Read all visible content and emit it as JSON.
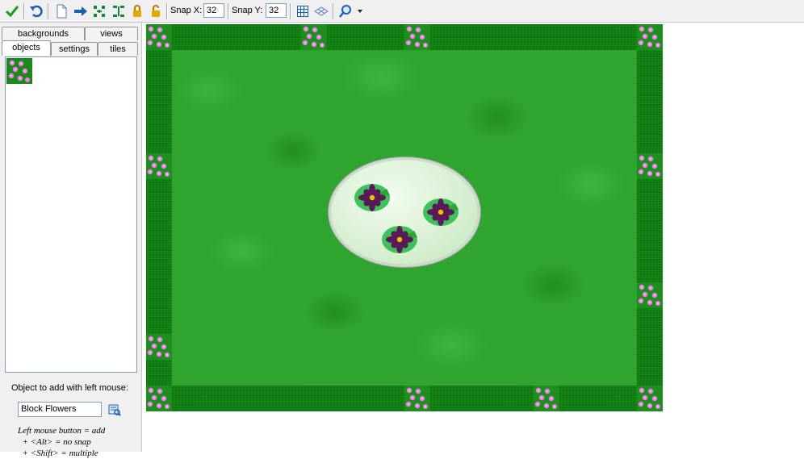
{
  "toolbar": {
    "buttons": [
      {
        "name": "confirm-button",
        "icon": "check-icon"
      },
      {
        "name": "undo-button",
        "icon": "undo-icon"
      },
      {
        "name": "clear-room-button",
        "icon": "blank-page-icon"
      },
      {
        "name": "shift-instances-button",
        "icon": "arrow-right-icon"
      },
      {
        "name": "mirror-horizontal-button",
        "icon": "expand-horizontal-icon"
      },
      {
        "name": "flip-vertical-button",
        "icon": "expand-vertical-icon"
      },
      {
        "name": "lock-instances-button",
        "icon": "lock-icon"
      },
      {
        "name": "unlock-instances-button",
        "icon": "unlock-icon"
      },
      {
        "name": "toggle-grid-button",
        "icon": "grid-icon"
      },
      {
        "name": "isometric-grid-button",
        "icon": "isometric-grid-icon"
      },
      {
        "name": "zoom-button",
        "icon": "magnifier-icon"
      }
    ],
    "snap_x_label": "Snap X:",
    "snap_x_value": "32",
    "snap_y_label": "Snap Y:",
    "snap_y_value": "32"
  },
  "tabs": {
    "row1": [
      "backgrounds",
      "views"
    ],
    "row2": [
      "objects",
      "settings",
      "tiles"
    ],
    "active": "objects"
  },
  "object_panel": {
    "add_label": "Object to add with left mouse:",
    "selected_object": "Block Flowers",
    "help_lines": [
      "Left mouse button = add",
      "  + <Alt> = no snap",
      "  + <Shift> = multiple"
    ]
  },
  "room": {
    "objects": [
      {
        "type": "Block Flowers",
        "count_visible": 11
      },
      {
        "type": "Lily Pad",
        "count_visible": 3
      },
      {
        "type": "Pond",
        "count_visible": 1
      }
    ]
  },
  "colors": {
    "hedge": "#0f7f12",
    "lawn": "#2fa52f",
    "flower": "#f07de6",
    "lily_flower": "#5a1a5a",
    "pond": "#d9f0d4"
  }
}
